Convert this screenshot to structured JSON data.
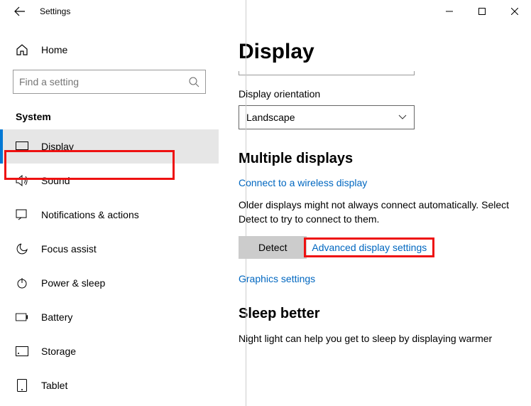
{
  "titlebar": {
    "title": "Settings"
  },
  "sidebar": {
    "home": "Home",
    "search_placeholder": "Find a setting",
    "section": "System",
    "items": [
      {
        "label": "Display",
        "active": true
      },
      {
        "label": "Sound"
      },
      {
        "label": "Notifications & actions"
      },
      {
        "label": "Focus assist"
      },
      {
        "label": "Power & sleep"
      },
      {
        "label": "Battery"
      },
      {
        "label": "Storage"
      },
      {
        "label": "Tablet"
      }
    ]
  },
  "main": {
    "title": "Display",
    "orientation_label": "Display orientation",
    "orientation_value": "Landscape",
    "multi_header": "Multiple displays",
    "wireless_link": "Connect to a wireless display",
    "older_text": "Older displays might not always connect automatically. Select Detect to try to connect to them.",
    "detect_btn": "Detect",
    "advanced_link": "Advanced display settings",
    "graphics_link": "Graphics settings",
    "sleep_header": "Sleep better",
    "sleep_text": "Night light can help you get to sleep by displaying warmer"
  }
}
